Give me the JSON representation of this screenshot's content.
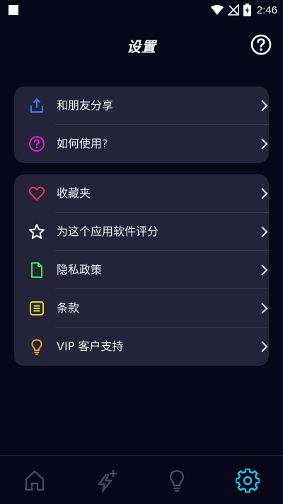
{
  "status_bar": {
    "time": "2:46",
    "icons": [
      "wifi-icon",
      "no-signal-icon",
      "battery-charging-icon"
    ]
  },
  "header": {
    "title": "设置",
    "help_icon": "help-circle-icon"
  },
  "groups": [
    {
      "items": [
        {
          "label": "和朋友分享",
          "icon": "share-icon",
          "color": "#3d7bff"
        },
        {
          "label": "如何使用?",
          "icon": "question-circle-icon",
          "color": "#d625d6"
        }
      ]
    },
    {
      "items": [
        {
          "label": "收藏夹",
          "icon": "heart-icon",
          "color": "#e8355a"
        },
        {
          "label": "为这个应用软件评分",
          "icon": "star-icon",
          "color": "#ffffff"
        },
        {
          "label": "隐私政策",
          "icon": "document-icon",
          "color": "#3ee34a"
        },
        {
          "label": "条款",
          "icon": "list-icon",
          "color": "#e8df2b"
        },
        {
          "label": "VIP 客户支持",
          "icon": "lightbulb-icon",
          "color": "#f59a3a"
        }
      ]
    }
  ],
  "bottom_nav": [
    {
      "icon": "home-icon",
      "active": false
    },
    {
      "icon": "lightning-plus-icon",
      "active": false
    },
    {
      "icon": "lightbulb-icon",
      "active": false
    },
    {
      "icon": "gear-icon",
      "active": true
    }
  ],
  "colors": {
    "background": "#08071a",
    "card": "#24233a",
    "nav_inactive": "#4a4960",
    "nav_active": "#22c8e8"
  }
}
